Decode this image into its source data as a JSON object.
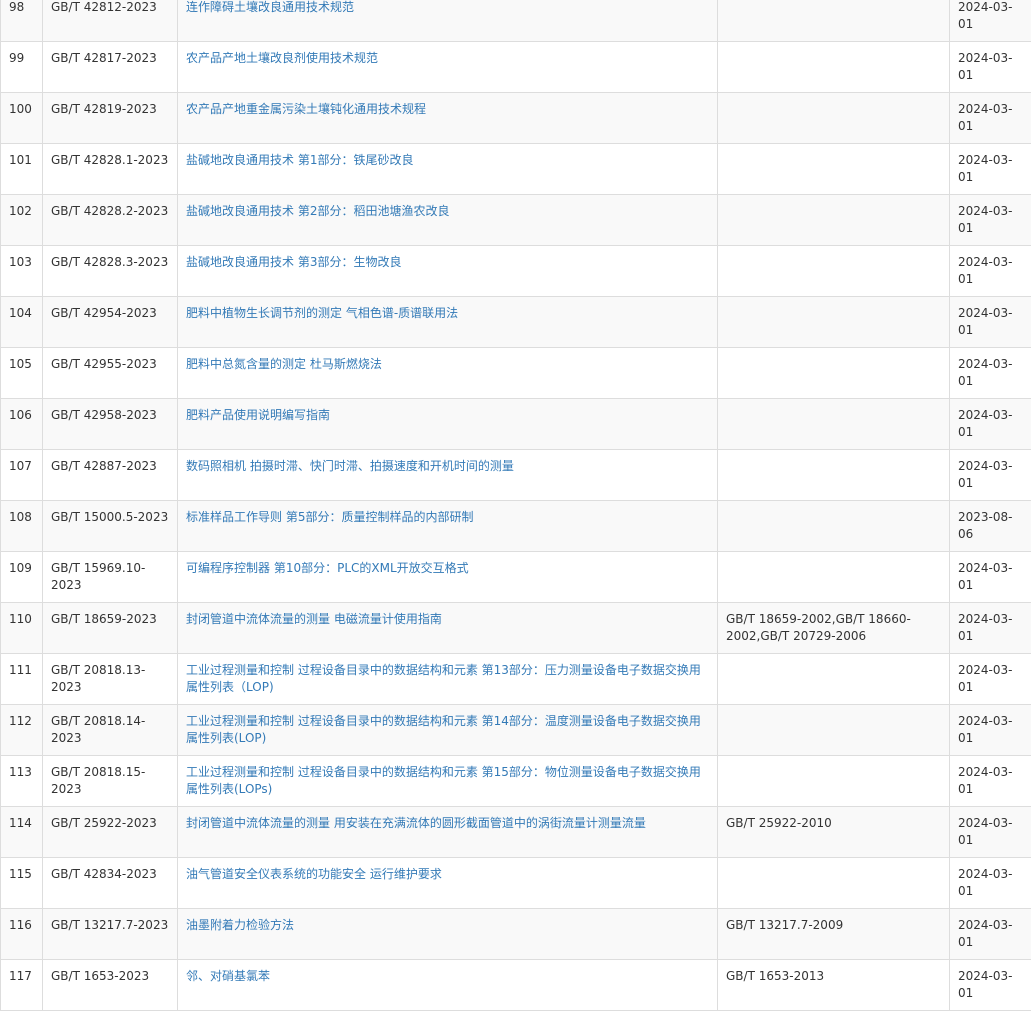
{
  "colors": {
    "link": "#337ab7",
    "border": "#dddddd",
    "stripe": "#f9f9f9",
    "text": "#333333"
  },
  "rows": [
    {
      "no": "98",
      "code": "GB/T 42812-2023",
      "name": "连作障碍土壤改良通用技术规范",
      "replaces": "",
      "date": "2024-03-01"
    },
    {
      "no": "99",
      "code": "GB/T 42817-2023",
      "name": "农产品产地土壤改良剂使用技术规范",
      "replaces": "",
      "date": "2024-03-01"
    },
    {
      "no": "100",
      "code": "GB/T 42819-2023",
      "name": "农产品产地重金属污染土壤钝化通用技术规程",
      "replaces": "",
      "date": "2024-03-01"
    },
    {
      "no": "101",
      "code": "GB/T 42828.1-2023",
      "name": "盐碱地改良通用技术 第1部分：铁尾砂改良",
      "replaces": "",
      "date": "2024-03-01"
    },
    {
      "no": "102",
      "code": "GB/T 42828.2-2023",
      "name": "盐碱地改良通用技术 第2部分：稻田池塘渔农改良",
      "replaces": "",
      "date": "2024-03-01"
    },
    {
      "no": "103",
      "code": "GB/T 42828.3-2023",
      "name": "盐碱地改良通用技术 第3部分：生物改良",
      "replaces": "",
      "date": "2024-03-01"
    },
    {
      "no": "104",
      "code": "GB/T 42954-2023",
      "name": "肥料中植物生长调节剂的测定 气相色谱-质谱联用法",
      "replaces": "",
      "date": "2024-03-01"
    },
    {
      "no": "105",
      "code": "GB/T 42955-2023",
      "name": "肥料中总氮含量的测定 杜马斯燃烧法",
      "replaces": "",
      "date": "2024-03-01"
    },
    {
      "no": "106",
      "code": "GB/T 42958-2023",
      "name": "肥料产品使用说明编写指南",
      "replaces": "",
      "date": "2024-03-01"
    },
    {
      "no": "107",
      "code": "GB/T 42887-2023",
      "name": "数码照相机 拍摄时滞、快门时滞、拍摄速度和开机时间的测量",
      "replaces": "",
      "date": "2024-03-01"
    },
    {
      "no": "108",
      "code": "GB/T 15000.5-2023",
      "name": "标准样品工作导则 第5部分：质量控制样品的内部研制",
      "replaces": "",
      "date": "2023-08-06"
    },
    {
      "no": "109",
      "code": "GB/T 15969.10-2023",
      "name": "可编程序控制器 第10部分：PLC的XML开放交互格式",
      "replaces": "",
      "date": "2024-03-01"
    },
    {
      "no": "110",
      "code": "GB/T 18659-2023",
      "name": "封闭管道中流体流量的测量 电磁流量计使用指南",
      "replaces": "GB/T 18659-2002,GB/T 18660-2002,GB/T 20729-2006",
      "date": "2024-03-01"
    },
    {
      "no": "111",
      "code": "GB/T 20818.13-2023",
      "name": "工业过程测量和控制 过程设备目录中的数据结构和元素 第13部分：压力测量设备电子数据交换用属性列表（LOP)",
      "replaces": "",
      "date": "2024-03-01"
    },
    {
      "no": "112",
      "code": "GB/T 20818.14-2023",
      "name": "工业过程测量和控制 过程设备目录中的数据结构和元素 第14部分：温度测量设备电子数据交换用属性列表(LOP)",
      "replaces": "",
      "date": "2024-03-01"
    },
    {
      "no": "113",
      "code": "GB/T 20818.15-2023",
      "name": "工业过程测量和控制 过程设备目录中的数据结构和元素 第15部分：物位测量设备电子数据交换用属性列表(LOPs)",
      "replaces": "",
      "date": "2024-03-01"
    },
    {
      "no": "114",
      "code": "GB/T 25922-2023",
      "name": "封闭管道中流体流量的测量 用安装在充满流体的圆形截面管道中的涡街流量计测量流量",
      "replaces": "GB/T 25922-2010",
      "date": "2024-03-01"
    },
    {
      "no": "115",
      "code": "GB/T 42834-2023",
      "name": "油气管道安全仪表系统的功能安全 运行维护要求",
      "replaces": "",
      "date": "2024-03-01"
    },
    {
      "no": "116",
      "code": "GB/T 13217.7-2023",
      "name": "油墨附着力检验方法",
      "replaces": "GB/T 13217.7-2009",
      "date": "2024-03-01"
    },
    {
      "no": "117",
      "code": "GB/T 1653-2023",
      "name": "邻、对硝基氯苯",
      "replaces": "GB/T 1653-2013",
      "date": "2024-03-01"
    }
  ]
}
